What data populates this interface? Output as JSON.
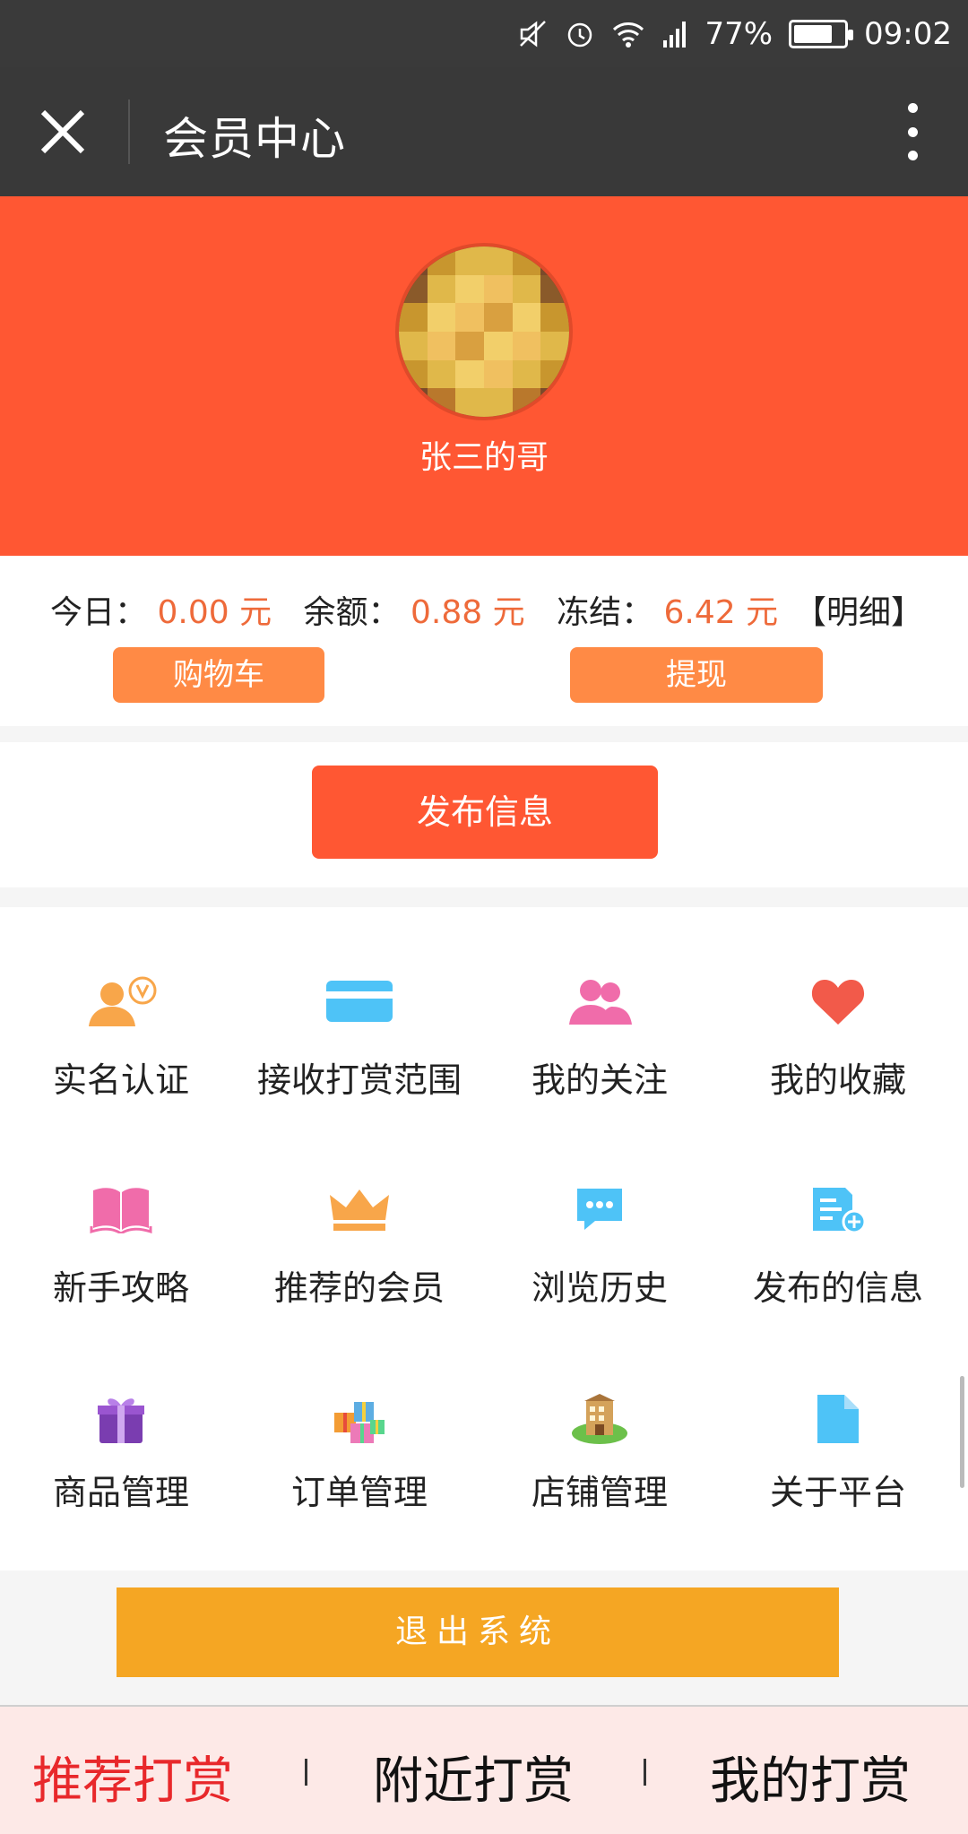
{
  "status_bar": {
    "battery": "77%",
    "battery_level": 0.77,
    "time": "09:02",
    "icons": [
      "mute-icon",
      "alarm-icon",
      "wifi-icon",
      "signal-icon",
      "battery-icon"
    ]
  },
  "titlebar": {
    "title": "会员中心",
    "close_icon": "close-icon",
    "more_icon": "more-icon"
  },
  "profile": {
    "username": "张三的哥"
  },
  "balance": {
    "today_label": "今日：",
    "today_amount": "0.00 元",
    "balance_label": "余额：",
    "balance_amount": "0.88 元",
    "frozen_label": "冻结：",
    "frozen_amount": "6.42 元",
    "detail_link": "【明细】",
    "cart_button": "购物车",
    "withdraw_button": "提现"
  },
  "publish": {
    "button": "发布信息"
  },
  "menu": {
    "items": [
      {
        "label": "实名认证",
        "icon": "verified-user-icon"
      },
      {
        "label": "接收打赏范围",
        "icon": "card-icon"
      },
      {
        "label": "我的关注",
        "icon": "followers-icon"
      },
      {
        "label": "我的收藏",
        "icon": "heart-icon"
      },
      {
        "label": "新手攻略",
        "icon": "book-icon"
      },
      {
        "label": "推荐的会员",
        "icon": "crown-icon"
      },
      {
        "label": "浏览历史",
        "icon": "chat-bubble-icon"
      },
      {
        "label": "发布的信息",
        "icon": "document-add-icon"
      },
      {
        "label": "商品管理",
        "icon": "gift-icon"
      },
      {
        "label": "订单管理",
        "icon": "gift-boxes-icon"
      },
      {
        "label": "店铺管理",
        "icon": "shop-building-icon"
      },
      {
        "label": "关于平台",
        "icon": "file-icon"
      }
    ]
  },
  "logout": {
    "button": "退出系统"
  },
  "bottom_nav": {
    "tabs": [
      "推荐打赏",
      "附近打赏",
      "我的打赏"
    ],
    "active": "推荐打赏"
  },
  "colors": {
    "primary": "#ff5733",
    "accent_orange": "#ff8a45",
    "logout": "#f5a623",
    "active_tab": "#e8282b"
  }
}
